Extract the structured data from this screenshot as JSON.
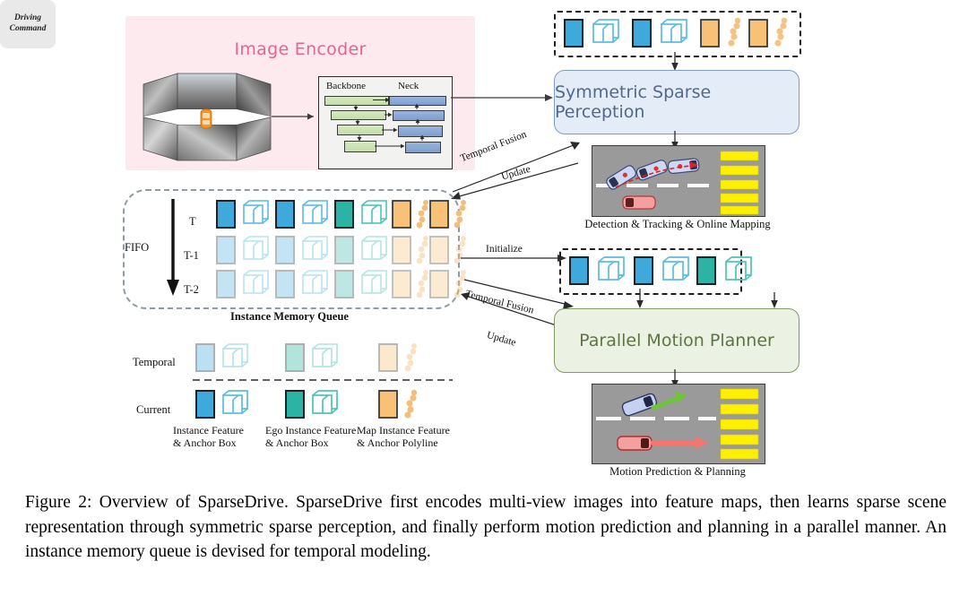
{
  "figure": {
    "encoder": {
      "title": "Image Encoder",
      "backbone_label": "Backbone",
      "neck_label": "Neck"
    },
    "modules": {
      "perception": "Symmetric Sparse Perception",
      "planner": "Parallel Motion Planner",
      "driving_command_line1": "Driving",
      "driving_command_line2": "Command"
    },
    "scenes": {
      "top_caption": "Detection & Tracking & Online Mapping",
      "bottom_caption": "Motion Prediction & Planning"
    },
    "arrows": {
      "temporal_fusion_top": "Temporal Fusion",
      "update_top": "Update",
      "initialize": "Initialize",
      "temporal_fusion_bottom": "Temporal Fusion",
      "update_bottom": "Update"
    },
    "memory_queue": {
      "title": "Instance Memory Queue",
      "fifo_label": "FIFO",
      "rows": [
        "T",
        "T-1",
        "T-2"
      ]
    },
    "legend": {
      "row_labels": [
        "Temporal",
        "Current"
      ],
      "items": [
        {
          "line1": "Instance Feature",
          "line2": "& Anchor Box"
        },
        {
          "line1": "Ego Instance Feature",
          "line2": "& Anchor Box"
        },
        {
          "line1": "Map Instance Feature",
          "line2": "& Anchor Polyline"
        }
      ]
    },
    "colors": {
      "instance_blue": "#3fa9dc",
      "ego_teal": "#2bb3a3",
      "map_orange": "#f7c277",
      "encoder_panel": "#fceaee",
      "encoder_title": "#e8638f",
      "perception_fill": "#e4ecf7",
      "perception_border": "#7d9dc4",
      "planner_fill": "#ebf2e3",
      "planner_border": "#7f9a62",
      "crosswalk_yellow": "#ffef00",
      "road_gray": "#9a9a9a"
    }
  },
  "caption": "Figure 2: Overview of SparseDrive. SparseDrive first encodes multi-view images into feature maps, then learns sparse scene representation through symmetric sparse perception, and finally perform motion prediction and planning in a parallel manner.  An instance memory queue is devised for temporal modeling."
}
